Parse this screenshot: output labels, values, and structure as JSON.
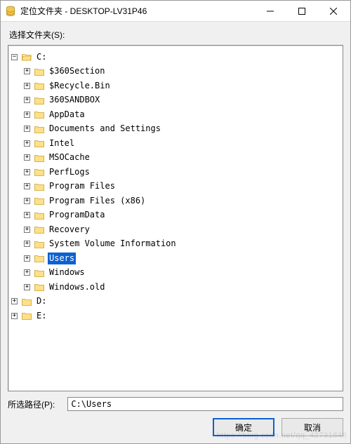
{
  "window": {
    "title": "定位文件夹 - DESKTOP-LV31P46"
  },
  "labels": {
    "select_folder": "选择文件夹(S):",
    "selected_path_label": "所选路径(P):"
  },
  "path_input_value": "C:\\Users",
  "buttons": {
    "ok": "确定",
    "cancel": "取消"
  },
  "icons": {
    "app": "database-icon",
    "minimize": "minimize-icon",
    "maximize": "maximize-icon",
    "close": "close-icon",
    "folder": "folder-icon",
    "folder_open": "folder-open-icon"
  },
  "tree": [
    {
      "label": "C:",
      "expanded": true,
      "children": [
        {
          "label": "$360Section"
        },
        {
          "label": "$Recycle.Bin"
        },
        {
          "label": "360SANDBOX"
        },
        {
          "label": "AppData"
        },
        {
          "label": "Documents and Settings"
        },
        {
          "label": "Intel"
        },
        {
          "label": "MSOCache"
        },
        {
          "label": "PerfLogs"
        },
        {
          "label": "Program Files"
        },
        {
          "label": "Program Files (x86)"
        },
        {
          "label": "ProgramData"
        },
        {
          "label": "Recovery"
        },
        {
          "label": "System Volume Information"
        },
        {
          "label": "Users",
          "selected": true
        },
        {
          "label": "Windows"
        },
        {
          "label": "Windows.old"
        }
      ]
    },
    {
      "label": "D:"
    },
    {
      "label": "E:"
    }
  ],
  "watermark": "https://blog.csdn.net/qq_42731846"
}
